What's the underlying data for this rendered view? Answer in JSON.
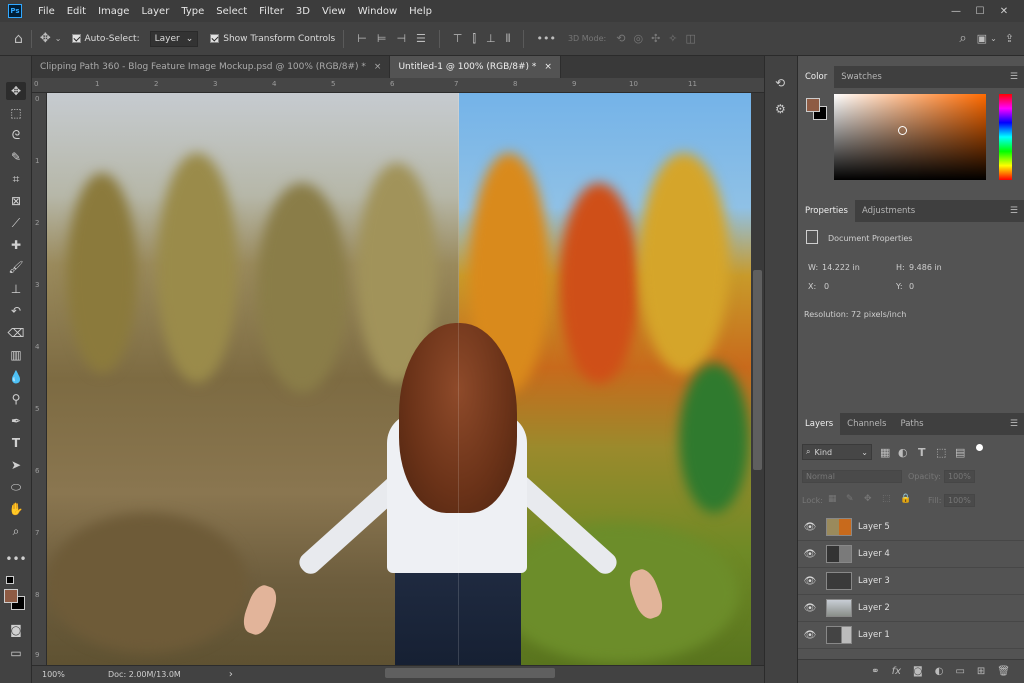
{
  "menubar": {
    "logo": "Ps",
    "items": [
      "File",
      "Edit",
      "Image",
      "Layer",
      "Type",
      "Select",
      "Filter",
      "3D",
      "View",
      "Window",
      "Help"
    ],
    "window_controls": [
      "—",
      "☐",
      "✕"
    ]
  },
  "options": {
    "auto_select_label": "Auto-Select:",
    "auto_select_value": "Layer",
    "show_transform_label": "Show Transform Controls",
    "mode_3d_label": "3D Mode:"
  },
  "tabs": [
    {
      "label": "Clipping Path 360 - Blog Feature Image Mockup.psd @ 100% (RGB/8#) *",
      "close": "×"
    },
    {
      "label": "Untitled-1 @ 100% (RGB/8#) *",
      "close": "×"
    }
  ],
  "rulers": {
    "top": [
      "0",
      "1",
      "2",
      "3",
      "4",
      "5",
      "6",
      "7",
      "8",
      "9",
      "10",
      "11"
    ],
    "left": [
      "0",
      "1",
      "2",
      "3",
      "4",
      "5",
      "6",
      "7",
      "8",
      "9"
    ]
  },
  "status": {
    "zoom": "100%",
    "doc": "Doc: 2.00M/13.0M",
    "arrow": "›"
  },
  "color_panel": {
    "tabs": [
      "Color",
      "Swatches"
    ],
    "foreground": "#8e5b44",
    "background": "#000000"
  },
  "properties_panel": {
    "tabs": [
      "Properties",
      "Adjustments"
    ],
    "doc_label": "Document Properties",
    "w_label": "W:",
    "w_value": "14.222 in",
    "h_label": "H:",
    "h_value": "9.486 in",
    "x_label": "X:",
    "x_value": "0",
    "y_label": "Y:",
    "y_value": "0",
    "resolution": "Resolution: 72 pixels/inch"
  },
  "layers_panel": {
    "tabs": [
      "Layers",
      "Channels",
      "Paths"
    ],
    "filter_kind": "Kind",
    "blend_mode": "Normal",
    "opacity_label": "Opacity:",
    "opacity_value": "100%",
    "lock_label": "Lock:",
    "fill_label": "Fill:",
    "fill_value": "100%",
    "layers": [
      {
        "name": "Layer 5"
      },
      {
        "name": "Layer 4"
      },
      {
        "name": "Layer 3"
      },
      {
        "name": "Layer 2"
      },
      {
        "name": "Layer 1"
      }
    ],
    "footer_icons": [
      "link-icon",
      "fx-icon",
      "mask-icon",
      "adjustment-icon",
      "folder-icon",
      "new-layer-icon",
      "trash-icon"
    ]
  },
  "icons": {
    "home": "home-icon",
    "move": "move-icon",
    "search": "search-icon"
  }
}
